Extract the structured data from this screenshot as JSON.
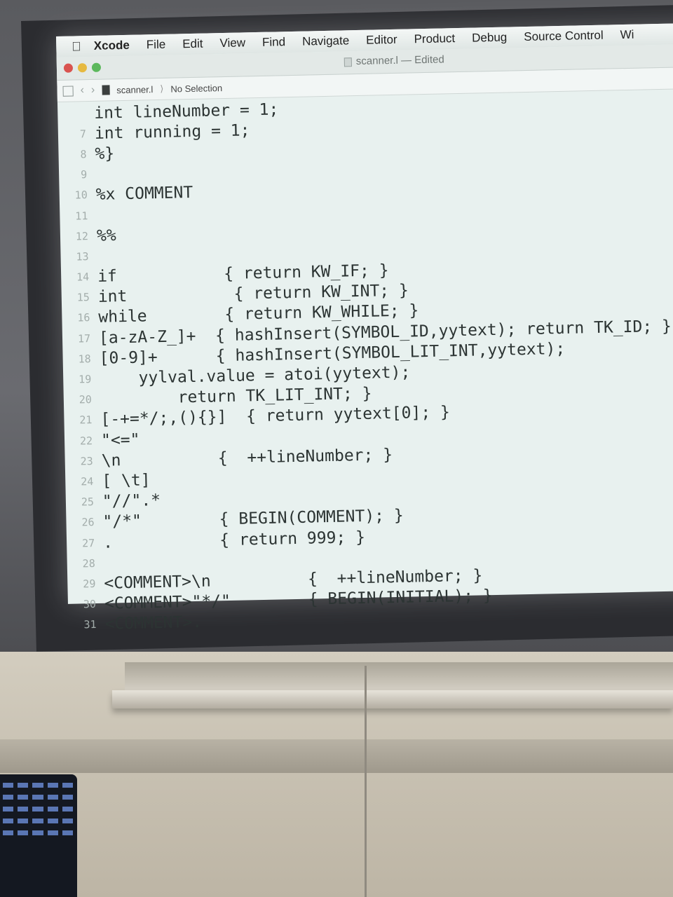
{
  "menubar": {
    "apple_icon": "apple-logo-icon",
    "items": [
      "Xcode",
      "File",
      "Edit",
      "View",
      "Find",
      "Navigate",
      "Editor",
      "Product",
      "Debug",
      "Source Control",
      "Wi"
    ]
  },
  "window": {
    "title": "scanner.l — Edited"
  },
  "jumpbar": {
    "file": "scanner.l",
    "selection": "No Selection"
  },
  "code": {
    "lines": [
      {
        "n": "",
        "text": "int lineNumber = 1;"
      },
      {
        "n": "7",
        "text": "int running = 1;"
      },
      {
        "n": "8",
        "text": "%}"
      },
      {
        "n": "9",
        "text": ""
      },
      {
        "n": "10",
        "text": "%x COMMENT"
      },
      {
        "n": "11",
        "text": ""
      },
      {
        "n": "12",
        "text": "%%"
      },
      {
        "n": "13",
        "text": ""
      },
      {
        "n": "14",
        "text": "if           { return KW_IF; }"
      },
      {
        "n": "15",
        "text": "int           { return KW_INT; }"
      },
      {
        "n": "16",
        "text": "while        { return KW_WHILE; }"
      },
      {
        "n": "17",
        "text": "[a-zA-Z_]+  { hashInsert(SYMBOL_ID,yytext); return TK_ID; }"
      },
      {
        "n": "18",
        "text": "[0-9]+      { hashInsert(SYMBOL_LIT_INT,yytext);"
      },
      {
        "n": "19",
        "text": "    yylval.value = atoi(yytext);"
      },
      {
        "n": "20",
        "text": "        return TK_LIT_INT; }"
      },
      {
        "n": "21",
        "text": "[-+=*/;,(){}]  { return yytext[0]; }"
      },
      {
        "n": "22",
        "text": "\"<=\""
      },
      {
        "n": "23",
        "text": "\\n          {  ++lineNumber; }"
      },
      {
        "n": "24",
        "text": "[ \\t]"
      },
      {
        "n": "25",
        "text": "\"//\".*"
      },
      {
        "n": "26",
        "text": "\"/*\"        { BEGIN(COMMENT); }"
      },
      {
        "n": "27",
        "text": ".           { return 999; }"
      },
      {
        "n": "28",
        "text": ""
      },
      {
        "n": "29",
        "text": "<COMMENT>\\n          {  ++lineNumber; }"
      },
      {
        "n": "30",
        "text": "<COMMENT>\"*/\"        { BEGIN(INITIAL); }"
      },
      {
        "n": "31",
        "text": "<COMMENT>."
      }
    ]
  }
}
